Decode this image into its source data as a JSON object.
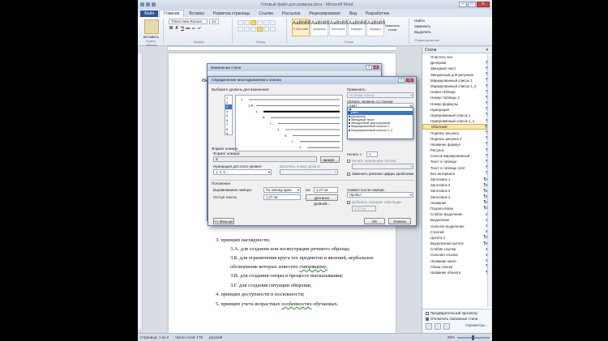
{
  "window": {
    "title": "Готовый файл для размера.docx - Microsoft Word",
    "minimize_glyph": "–",
    "maximize_glyph": "□",
    "close_glyph": "✕"
  },
  "ribbon_tabs": [
    {
      "label": "Файл"
    },
    {
      "label": "Главная"
    },
    {
      "label": "Вставка"
    },
    {
      "label": "Разметка страницы"
    },
    {
      "label": "Ссылки"
    },
    {
      "label": "Рассылки"
    },
    {
      "label": "Рецензирование"
    },
    {
      "label": "Вид"
    },
    {
      "label": "Разработчик"
    }
  ],
  "ribbon": {
    "paste_label": "Вставить",
    "clipboard_label": "Буфер обмена",
    "font_name": "Times New Roman",
    "font_size": "14",
    "font_group_label": "Шрифт",
    "paragraph_group_label": "Абзац",
    "styles_group_label": "Стили",
    "editing_group_label": "Редактирование",
    "format_buttons": [
      "Ж",
      "К",
      "Ч",
      "abc",
      "x₂",
      "x²"
    ],
    "change_styles_label": "Изменить стили",
    "editing": [
      "Найти",
      "Заменить",
      "Выделить"
    ],
    "style_gallery": [
      {
        "sample": "АаВbВбI",
        "name": "¶ Обычный"
      },
      {
        "sample": "АаВbВб",
        "name": "Дочерник"
      },
      {
        "sample": "АаВbВб",
        "name": "Заголовок"
      },
      {
        "sample": "АаВbВб",
        "name": "Маркиро"
      },
      {
        "sample": "АаВbВб",
        "name": "Маркиро"
      }
    ]
  },
  "document": {
    "lines": [
      {
        "text": "Осн",
        "bold": true
      },
      {
        "text": "3. принцип наглядности;"
      },
      {
        "text": "3.А. для создания или иллюстрации речевого образца;"
      },
      {
        "text": "3.Б. для ограничения круга тех предметов и явлений, вербальное"
      },
      {
        "text": "обозначение которых известно",
        "wavy": "говорящему;"
      },
      {
        "text": "3.В. для создания опоры в процессе высказывания;"
      },
      {
        "text": "3.Г. для создания ситуации общения;"
      },
      {
        "text": "4. принцип доступности и посильности;"
      },
      {
        "text": "5. принцип учета возрастных",
        "wavy": "особенностях",
        "tail": "обучаемых."
      }
    ]
  },
  "statusbar": {
    "page": "Страница: 1 из 2",
    "words": "Число слов: 179",
    "lang": "русский",
    "zoom": "90%"
  },
  "styles_pane": {
    "title": "Стили",
    "close": "✕",
    "items": [
      {
        "label": "Очистить все",
        "mark": ""
      },
      {
        "label": "Дочерник",
        "mark": "¶"
      },
      {
        "label": "Звездный текст",
        "mark": "¶"
      },
      {
        "label": "Звездочный для рисунков",
        "mark": "¶"
      },
      {
        "label": "Маркированный список 1",
        "mark": "¶"
      },
      {
        "label": "Маркированный список 1_2",
        "mark": "¶"
      },
      {
        "label": "Новая таблица",
        "mark": "¶"
      },
      {
        "label": "Номер таблицы 2",
        "mark": "¶"
      },
      {
        "label": "Номер формулы",
        "mark": "¶"
      },
      {
        "label": "Нумерация",
        "mark": "¶"
      },
      {
        "label": "Нумерованный список 1",
        "mark": "¶"
      },
      {
        "label": "Нумерованный список 1_1",
        "mark": "¶"
      },
      {
        "label": "Обычный",
        "mark": "¶",
        "selected": true
      },
      {
        "label": "Подпись рисунка",
        "mark": "¶"
      },
      {
        "label": "Подпись рисунка 2",
        "mark": "¶"
      },
      {
        "label": "Название формул",
        "mark": "¶"
      },
      {
        "label": "Рисунок",
        "mark": "¶"
      },
      {
        "label": "Список маркированный",
        "mark": "¶"
      },
      {
        "label": "Текст в таблице",
        "mark": "¶"
      },
      {
        "label": "Текст в таблице 12пт",
        "mark": "¶"
      },
      {
        "label": "Без интервала",
        "mark": "¶"
      },
      {
        "label": "Заголовок 1",
        "mark": "¶a"
      },
      {
        "label": "Заголовок 2",
        "mark": "¶a"
      },
      {
        "label": "Заголовок 3",
        "mark": "¶a"
      },
      {
        "label": "Заголовок 4",
        "mark": "¶a"
      },
      {
        "label": "Название",
        "mark": "¶a"
      },
      {
        "label": "Подзаголовок",
        "mark": "¶a"
      },
      {
        "label": "Слабое выделение",
        "mark": "a"
      },
      {
        "label": "Выделение",
        "mark": "a"
      },
      {
        "label": "Сильное выделение",
        "mark": "a"
      },
      {
        "label": "Строгий",
        "mark": "a"
      },
      {
        "label": "Цитата 2",
        "mark": "¶a"
      },
      {
        "label": "Выделенная цитата",
        "mark": "¶a"
      },
      {
        "label": "Слабая ссылка",
        "mark": "a"
      },
      {
        "label": "Сильная ссылка",
        "mark": "a"
      },
      {
        "label": "Название книги",
        "mark": "a"
      },
      {
        "label": "Абзац списка",
        "mark": "¶"
      },
      {
        "label": "Название объекта",
        "mark": "¶"
      }
    ],
    "preview_checkbox": "Предварительный просмотр",
    "disable_linked": "Отключить связанные стили",
    "options_link": "Параметры..."
  },
  "back_dialog": {
    "title": "Изменение стиля",
    "help": "?",
    "close": "✕"
  },
  "dialog": {
    "title": "Определение многоуровневого списка",
    "help": "?",
    "close": "✕",
    "choose_level_label": "Выберите уровень для изменения:",
    "levels": [
      "1",
      "2",
      "3",
      "4",
      "5",
      "6",
      "7",
      "8",
      "9"
    ],
    "apply_to_label": "Применить:",
    "apply_to_value": "ко всему списку",
    "link_level_label": "Связать уровень со стилем:",
    "link_level_value": "(нет)",
    "dropdown_items": [
      "(нет)",
      "Дочерник",
      "Звездный текст",
      "Звездочный для рисунков",
      "Маркированный список 1",
      "Маркированный список 1_2"
    ],
    "preview_numbers": [
      "1.",
      "1.А.",
      "1.",
      "a.",
      "i.",
      "1.",
      "a.",
      "i.",
      "1."
    ],
    "number_format_section": "Формат номера",
    "number_format_label": "Формат номера:",
    "number_format_value": "3.",
    "font_button": "Шрифт...",
    "number_style_label": "Нумерация для этого уровня:",
    "number_style_value": "1, 2, 3, ...",
    "include_level_label": "Включить номер уровня:",
    "start_at_label": "Начать с:",
    "start_at_value": "1",
    "restart_label": "Начать нумерацию заново:",
    "legal_label": "Заменить римские цифры арабскими",
    "position_section": "Положение",
    "alignment_label": "Выравнивание номера:",
    "alignment_value": "По левому краю",
    "at_label": "на:",
    "at_value": "1,27 см",
    "indent_label": "Отступ текста:",
    "indent_value": "1,27 см",
    "set_all_button": "Для всех уровней...",
    "follow_label": "Символ после номера:",
    "follow_value": "Пробел",
    "tab_add_label": "Добавить позицию табуляции:",
    "tab_value": "1,27 см",
    "less_button": "<< Меньше",
    "ok_button": "ОК",
    "cancel_button": "Отмена"
  }
}
